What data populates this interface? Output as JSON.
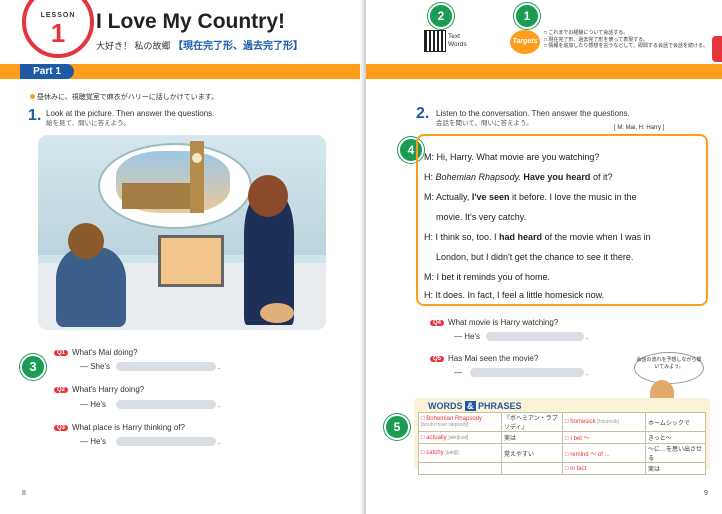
{
  "left_page": {
    "lesson_word": "LESSON",
    "lesson_number": "1",
    "title": "I Love My Country!",
    "subtitle_jp": "大好き！ 私の故郷",
    "subtitle_grammar": "【現在完了形、過去完了形】",
    "part_label": "Part 1",
    "intro_jp": "昼休みに、視聴覚室で麻衣がハリーに話しかけています。",
    "q1_number": "1.",
    "q1_text": "Look at the picture. Then answer the questions.",
    "q1_jp": "絵を見て、問いに答えよう。",
    "callout_3": "3",
    "questions": [
      {
        "tag": "Q1",
        "text": "What's Mai doing?",
        "answer_prefix": "— She's"
      },
      {
        "tag": "Q2",
        "text": "What's Harry doing?",
        "answer_prefix": "— He's"
      },
      {
        "tag": "Q3",
        "text": "What place is Harry thinking of?",
        "answer_prefix": "— He's"
      }
    ],
    "period": ".",
    "page_number": "8"
  },
  "right_page": {
    "callout_2": "2",
    "callout_1": "1",
    "qr_text": "Text",
    "qr_words": "Words",
    "targets_label": "Targets",
    "goals": [
      "□ これまでの経験について会話する。",
      "□ 現在完了形、過去完了形を使って表現する。",
      "□ 情報を追加したり感想を言うなどして、即興する会話で会話を続ける。"
    ],
    "q2_number": "2.",
    "q2_text": "Listen to the conversation. Then answer the questions.",
    "q2_jp": "会話を聞いて、問いに答えよう。",
    "speakers": "[ M: Mai, H: Harry ]",
    "callout_4": "4",
    "conversation": [
      {
        "pre": "M: Hi, Harry.  What movie are you watching?",
        "bold": "",
        "post": ""
      },
      {
        "pre": "H: ",
        "italic": "Bohemian Rhapsody.",
        "bold": " Have you heard",
        "post": " of it?"
      },
      {
        "pre": "M: Actually, ",
        "bold": "I've seen",
        "post": " it before.  I love the music in the"
      },
      {
        "pre": "movie.  It's very catchy.",
        "bold": "",
        "post": ""
      },
      {
        "pre": "H: I think so, too.  I ",
        "bold": "had heard",
        "post": " of the movie when I was in"
      },
      {
        "pre": "London, but I didn't get the chance to see it there.",
        "bold": "",
        "post": ""
      },
      {
        "pre": "M: I bet it reminds you of home.",
        "bold": "",
        "post": ""
      },
      {
        "pre": "H: It does.  In fact, I feel a little homesick now.",
        "bold": "",
        "post": ""
      }
    ],
    "questions": [
      {
        "tag": "Q4",
        "text": "What movie is Harry watching?",
        "answer_prefix": "— He's"
      },
      {
        "tag": "Q5",
        "text": "Has Mai seen the movie?",
        "answer_prefix": "—"
      }
    ],
    "thought_bubble": "会話の流れを予想しながら聞いてみよう。",
    "callout_5": "5",
    "words_title_1": "WORDS",
    "words_title_amp": "&",
    "words_title_2": "PHRASES",
    "words": [
      {
        "en": "□ Bohemian Rhapsody",
        "ph": "[bouhíːmiən rǽpsədi]",
        "jp": "『ボヘミアン・ラプソディ』",
        "en2": "□ homesick",
        "ph2": "[hóumsik]",
        "jp2": "ホームシックで"
      },
      {
        "en": "□ actually",
        "ph": "[ǽktʃuəli]",
        "jp": "実は",
        "en2": "□ I bet ～",
        "ph2": "",
        "jp2": "きっと～"
      },
      {
        "en": "□ catchy",
        "ph": "[kǽtʃi]",
        "jp": "覚えやすい",
        "en2": "□ remind ～ of ...",
        "ph2": "",
        "jp2": "～に…を思い出させる"
      },
      {
        "en": "",
        "ph": "",
        "jp": "",
        "en2": "□ in fact",
        "ph2": "",
        "jp2": "実は"
      }
    ],
    "page_number": "9"
  }
}
